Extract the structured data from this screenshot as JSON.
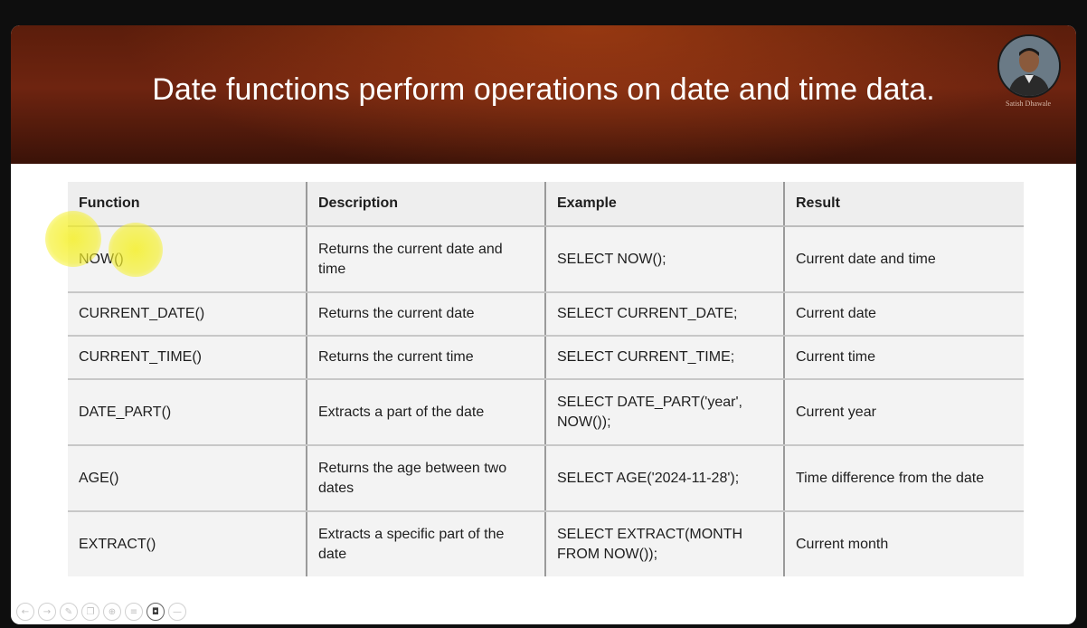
{
  "slide": {
    "title": "Date functions perform operations on date and time data.",
    "presenter_caption": "Satish Dhawale"
  },
  "table": {
    "headers": [
      "Function",
      "Description",
      "Example",
      "Result"
    ],
    "rows": [
      [
        "NOW()",
        "Returns the current date and time",
        "SELECT NOW();",
        "Current date and time"
      ],
      [
        "CURRENT_DATE()",
        "Returns the current date",
        "SELECT CURRENT_DATE;",
        "Current date"
      ],
      [
        "CURRENT_TIME()",
        "Returns the current time",
        "SELECT CURRENT_TIME;",
        "Current time"
      ],
      [
        "DATE_PART()",
        "Extracts a part of the date",
        "SELECT DATE_PART('year', NOW());",
        "Current year"
      ],
      [
        "AGE()",
        "Returns the age between two dates",
        "SELECT AGE('2024-11-28');",
        "Time difference from the date"
      ],
      [
        "EXTRACT()",
        "Extracts a specific part of the date",
        "SELECT EXTRACT(MONTH FROM NOW());",
        "Current month"
      ]
    ]
  },
  "toolbar": {
    "icons": [
      "previous-icon",
      "next-icon",
      "pen-icon",
      "copy-icon",
      "zoom-icon",
      "menu-icon",
      "camera-icon",
      "more-icon"
    ],
    "glyphs": [
      "←",
      "→",
      "✎",
      "❐",
      "⊕",
      "≡",
      "◘",
      "—"
    ]
  },
  "colors": {
    "header_dark": "#5b1d0b",
    "header_accent": "#c64e16",
    "highlighter": "#f5f028"
  }
}
